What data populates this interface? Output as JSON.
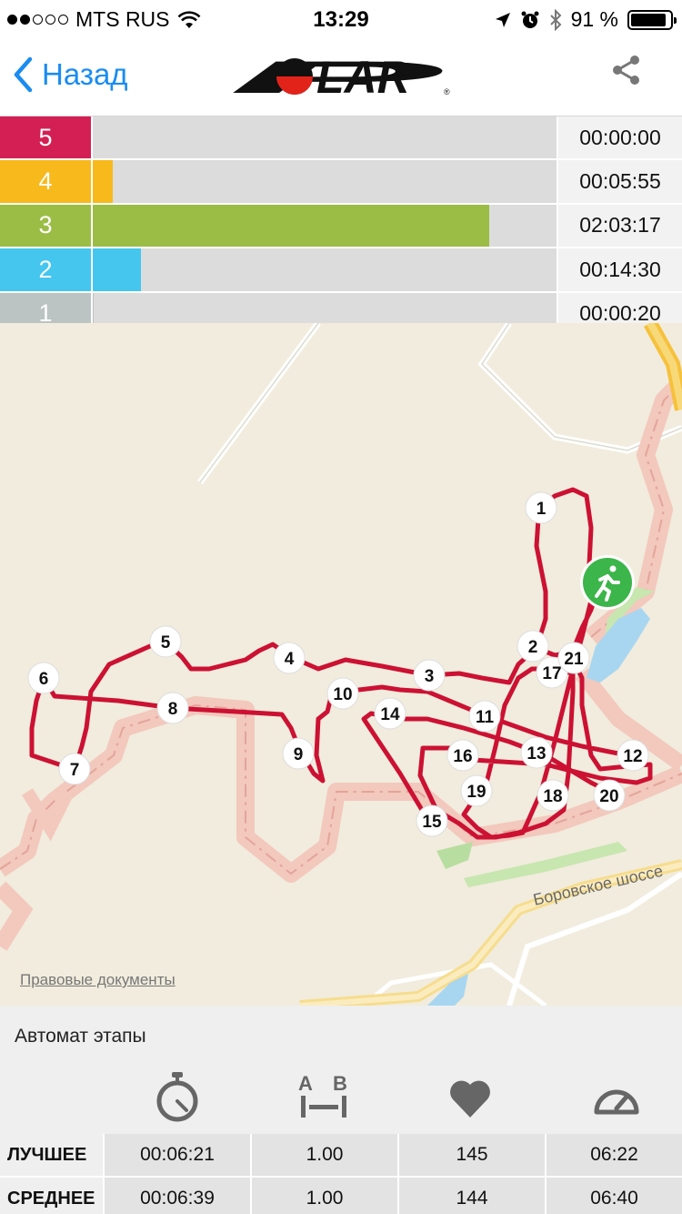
{
  "status_bar": {
    "carrier": "MTS RUS",
    "time": "13:29",
    "battery": "91 %",
    "battery_level": 0.91
  },
  "nav": {
    "back_label": "Назад",
    "logo_text": "POLAR"
  },
  "zones": [
    {
      "number": "5",
      "time": "00:00:00",
      "fill": 0.0,
      "color": "#d31f53"
    },
    {
      "number": "4",
      "time": "00:05:55",
      "fill": 0.043,
      "color": "#f7b91c"
    },
    {
      "number": "3",
      "time": "02:03:17",
      "fill": 0.855,
      "color": "#9cbd45"
    },
    {
      "number": "2",
      "time": "00:14:30",
      "fill": 0.104,
      "color": "#45c6ef"
    },
    {
      "number": "1",
      "time": "00:00:20",
      "fill": 0.002,
      "color": "#bcc3c3"
    }
  ],
  "map": {
    "road_label": "Боровское шоссе",
    "legal_link": "Правовые документы",
    "route_color": "#cc1133",
    "lap_markers": [
      "1",
      "2",
      "3",
      "4",
      "5",
      "6",
      "7",
      "8",
      "9",
      "10",
      "11",
      "12",
      "13",
      "14",
      "15",
      "16",
      "17",
      "18",
      "19",
      "20",
      "21"
    ]
  },
  "laps": {
    "title": "Автомат этапы",
    "icons": [
      "stopwatch-icon",
      "distance-ab-icon",
      "heart-icon",
      "speedometer-icon"
    ],
    "best": {
      "label": "ЛУЧШЕЕ",
      "values": [
        "00:06:21",
        "1.00",
        "145",
        "06:22"
      ]
    },
    "average": {
      "label": "СРЕДНЕЕ",
      "values": [
        "00:06:39",
        "1.00",
        "144",
        "06:40"
      ]
    }
  }
}
